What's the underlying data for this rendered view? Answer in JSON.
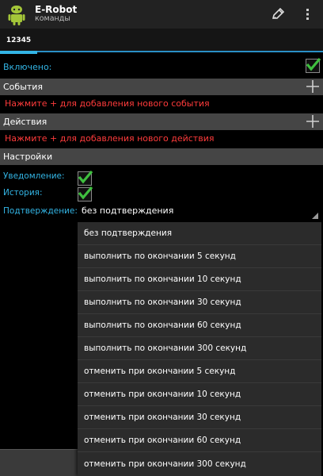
{
  "app": {
    "title": "E-Robot",
    "subtitle": "команды"
  },
  "tabs": [
    {
      "label": "12345",
      "active": true
    }
  ],
  "enabled": {
    "label": "Включено:",
    "checked": true
  },
  "events": {
    "header": "События",
    "hint": "Нажмите + для добавления нового события"
  },
  "actions": {
    "header": "Действия",
    "hint": "Нажмите + для добавления нового действия"
  },
  "settings": {
    "header": "Настройки",
    "notification": {
      "label": "Уведомление:",
      "checked": true
    },
    "history": {
      "label": "История:",
      "checked": true
    },
    "confirmation": {
      "label": "Подтверждение:",
      "value": "без подтверждения"
    }
  },
  "dropdown": {
    "options": [
      "без подтверждения",
      "выполнить по окончании 5 секунд",
      "выполнить по окончании 10 секунд",
      "выполнить по окончании 30 секунд",
      "выполнить по окончании 60 секунд",
      "выполнить по окончании 300 секунд",
      "отменить при окончании 5 секунд",
      "отменить при окончании 10 секунд",
      "отменить при окончании 30 секунд",
      "отменить при окончании 60 секунд",
      "отменить при окончании 300 секунд"
    ]
  },
  "colors": {
    "accent": "#33b5e5",
    "hint": "#ff3b3b",
    "check": "#3fbf3f",
    "section_bg": "#454545",
    "actionbar_bg": "#222222"
  },
  "icons": {
    "app": "android-robot-icon",
    "edit": "pencil-icon",
    "overflow": "overflow-menu-icon",
    "add": "plus-icon",
    "check": "checkmark-icon"
  }
}
